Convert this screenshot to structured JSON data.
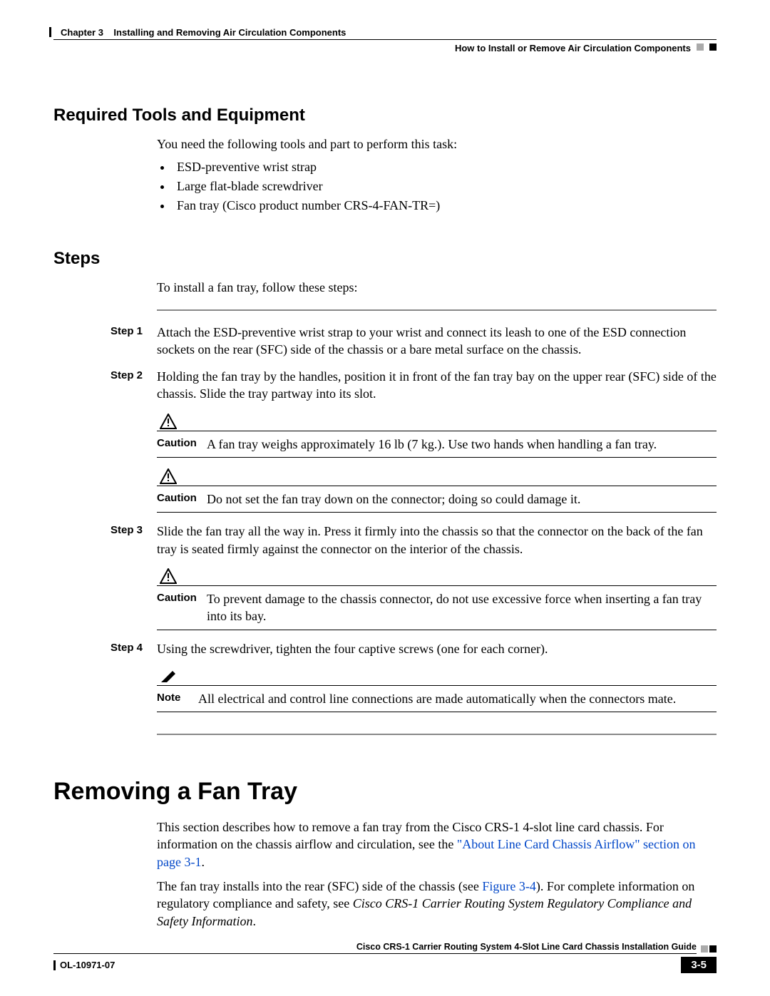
{
  "header": {
    "chapter_label": "Chapter 3",
    "chapter_title": "Installing and Removing Air Circulation Components",
    "section_title": "How to Install or Remove Air Circulation Components"
  },
  "tools": {
    "heading": "Required Tools and Equipment",
    "intro": "You need the following tools and part to perform this task:",
    "items": [
      "ESD-preventive wrist strap",
      "Large flat-blade screwdriver",
      "Fan tray (Cisco product number CRS-4-FAN-TR=)"
    ]
  },
  "steps": {
    "heading": "Steps",
    "intro": "To install a fan tray, follow these steps:",
    "list": [
      {
        "label": "Step 1",
        "text": "Attach the ESD-preventive wrist strap to your wrist and connect its leash to one of the ESD connection sockets on the rear (SFC) side of the chassis or a bare metal surface on the chassis."
      },
      {
        "label": "Step 2",
        "text": "Holding the fan tray by the handles, position it in front of the fan tray bay on the upper rear (SFC) side of the chassis. Slide the tray partway into its slot."
      },
      {
        "label": "Step 3",
        "text": "Slide the fan tray all the way in. Press it firmly into the chassis so that the connector on the back of the fan tray is seated firmly against the connector on the interior of the chassis."
      },
      {
        "label": "Step 4",
        "text": "Using the screwdriver, tighten the four captive screws (one for each corner)."
      }
    ],
    "caution_label": "Caution",
    "note_label": "Note",
    "caution1": "A fan tray weighs approximately 16 lb (7 kg.). Use two hands when handling a fan tray.",
    "caution2": "Do not set the fan tray down on the connector; doing so could damage it.",
    "caution3": "To prevent damage to the chassis connector, do not use excessive force when inserting a fan tray into its bay.",
    "note1": "All electrical and control line connections are made automatically when the connectors mate."
  },
  "removing": {
    "heading": "Removing a Fan Tray",
    "p1a": "This section describes how to remove a fan tray from the Cisco CRS-1 4-slot line card chassis. For information on the chassis airflow and circulation, see the ",
    "p1_link": "\"About Line Card Chassis Airflow\" section on page 3-1",
    "p1b": ".",
    "p2a": "The fan tray installs into the rear (SFC) side of the chassis (see ",
    "p2_link": "Figure 3-4",
    "p2b": "). For complete information on regulatory compliance and safety, see ",
    "p2_italic": "Cisco CRS-1 Carrier Routing System Regulatory Compliance and Safety Information",
    "p2c": "."
  },
  "footer": {
    "guide_title": "Cisco CRS-1 Carrier Routing System 4-Slot Line Card Chassis Installation Guide",
    "doc_number": "OL-10971-07",
    "page": "3-5"
  }
}
